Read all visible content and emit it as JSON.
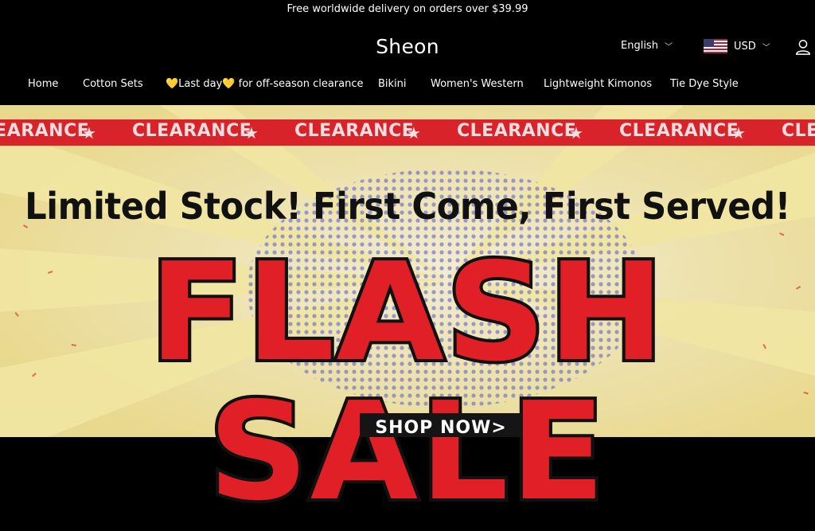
{
  "announcement": "Free worldwide delivery on orders over $39.99",
  "brand": "Sheon",
  "language": "English",
  "currency": "USD",
  "nav": {
    "home": "Home",
    "cotton_sets": "Cotton Sets",
    "last_day": "💛Last day💛 for off-season clearance",
    "bikini": "Bikini",
    "womens_western": "Women's Western",
    "kimonos": "Lightweight Kimonos",
    "tie_dye": "Tie Dye Style"
  },
  "banner": {
    "strip_word": "CLEARANCE",
    "headline": "Limited Stock! First Come, First Served!",
    "flash": "FLASH SALE",
    "cta": "SHOP NOW>"
  },
  "colors": {
    "red": "#d8232a",
    "cream": "#efe4b8",
    "black": "#000000"
  }
}
